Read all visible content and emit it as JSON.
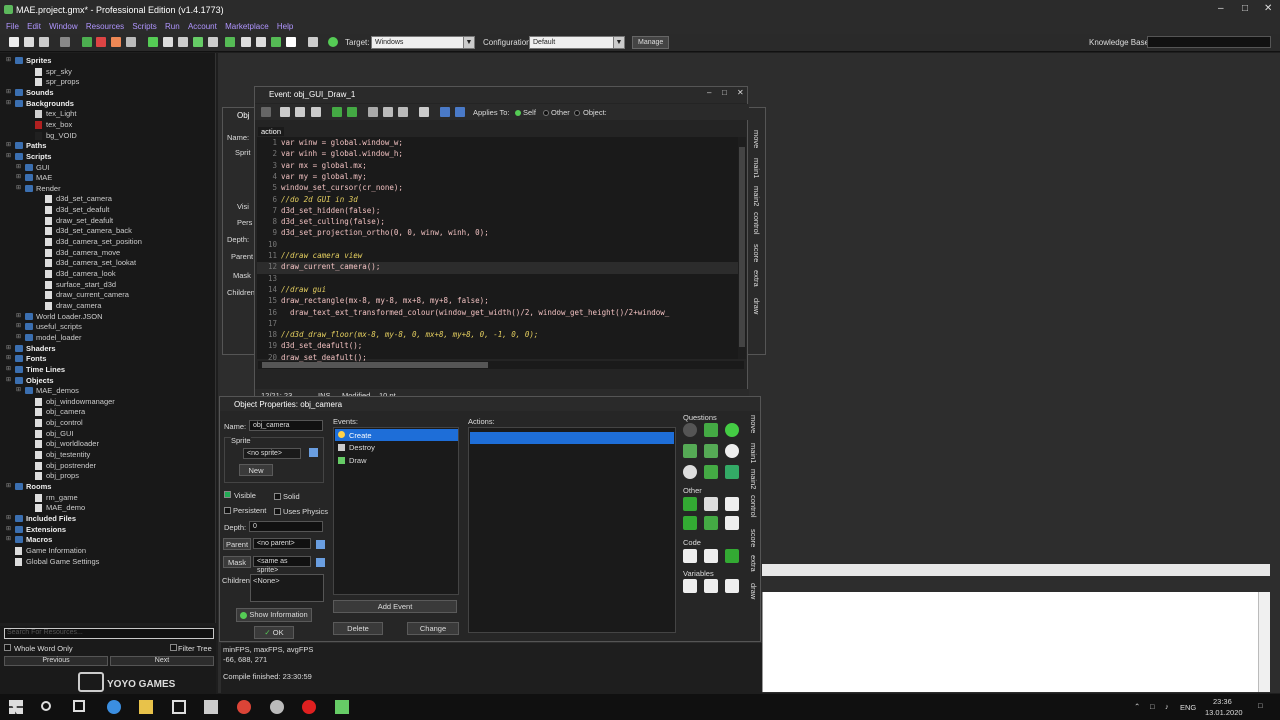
{
  "app": {
    "title": "MAE.project.gmx* - Professional Edition (v1.4.1773)"
  },
  "menu": [
    "File",
    "Edit",
    "Window",
    "Resources",
    "Scripts",
    "Run",
    "Account",
    "Marketplace",
    "Help"
  ],
  "toolbar": {
    "target_label": "Target:",
    "target_value": "Windows",
    "config_label": "Configuration:",
    "config_value": "Default",
    "manage_label": "Manage",
    "kb_label": "Knowledge Base:"
  },
  "tree": [
    {
      "label": "Sprites",
      "bold": true,
      "level": 1,
      "folder": true
    },
    {
      "label": "spr_sky",
      "level": 3
    },
    {
      "label": "spr_props",
      "level": 3
    },
    {
      "label": "Sounds",
      "bold": true,
      "level": 1,
      "folder": true
    },
    {
      "label": "Backgrounds",
      "bold": true,
      "level": 1,
      "folder": true
    },
    {
      "label": "tex_Light",
      "level": 3,
      "color": "#d0d0d0"
    },
    {
      "label": "tex_box",
      "level": 3,
      "color": "#b02020"
    },
    {
      "label": "bg_VOID",
      "level": 3,
      "color": "#202020"
    },
    {
      "label": "Paths",
      "bold": true,
      "level": 1,
      "folder": true
    },
    {
      "label": "Scripts",
      "bold": true,
      "level": 1,
      "folder": true
    },
    {
      "label": "GUI",
      "level": 2,
      "folder": true
    },
    {
      "label": "MAE",
      "level": 2,
      "folder": true
    },
    {
      "label": "Render",
      "level": 2,
      "folder": true
    },
    {
      "label": "d3d_set_camera",
      "level": 4
    },
    {
      "label": "d3d_set_deafult",
      "level": 4
    },
    {
      "label": "draw_set_deafult",
      "level": 4
    },
    {
      "label": "d3d_set_camera_back",
      "level": 4
    },
    {
      "label": "d3d_camera_set_position",
      "level": 4
    },
    {
      "label": "d3d_camera_move",
      "level": 4
    },
    {
      "label": "d3d_camera_set_lookat",
      "level": 4
    },
    {
      "label": "d3d_camera_look",
      "level": 4
    },
    {
      "label": "surface_start_d3d",
      "level": 4
    },
    {
      "label": "draw_current_camera",
      "level": 4
    },
    {
      "label": "draw_camera",
      "level": 4
    },
    {
      "label": "World Loader.JSON",
      "level": 2,
      "folder": true
    },
    {
      "label": "useful_scripts",
      "level": 2,
      "folder": true
    },
    {
      "label": "model_loader",
      "level": 2,
      "folder": true
    },
    {
      "label": "Shaders",
      "bold": true,
      "level": 1,
      "folder": true
    },
    {
      "label": "Fonts",
      "bold": true,
      "level": 1,
      "folder": true
    },
    {
      "label": "Time Lines",
      "bold": true,
      "level": 1,
      "folder": true
    },
    {
      "label": "Objects",
      "bold": true,
      "level": 1,
      "folder": true
    },
    {
      "label": "MAE_demos",
      "level": 2,
      "folder": true
    },
    {
      "label": "obj_windowmanager",
      "level": 3
    },
    {
      "label": "obj_camera",
      "level": 3
    },
    {
      "label": "obj_control",
      "level": 3
    },
    {
      "label": "obj_GUI",
      "level": 3
    },
    {
      "label": "obj_worldloader",
      "level": 3
    },
    {
      "label": "obj_testentity",
      "level": 3
    },
    {
      "label": "obj_postrender",
      "level": 3
    },
    {
      "label": "obj_props",
      "level": 3
    },
    {
      "label": "Rooms",
      "bold": true,
      "level": 1,
      "folder": true
    },
    {
      "label": "rm_game",
      "level": 3
    },
    {
      "label": "MAE_demo",
      "level": 3
    },
    {
      "label": "Included Files",
      "bold": true,
      "level": 1,
      "folder": true
    },
    {
      "label": "Extensions",
      "bold": true,
      "level": 1,
      "folder": true
    },
    {
      "label": "Macros",
      "bold": true,
      "level": 1,
      "folder": true
    },
    {
      "label": "Game Information",
      "level": 1
    },
    {
      "label": "Global Game Settings",
      "level": 1
    }
  ],
  "search": {
    "placeholder": "Search For Resources...",
    "whole_word": "Whole Word Only",
    "filter": "Filter Tree",
    "previous": "Previous",
    "next": "Next"
  },
  "logo": "YOYO GAMES",
  "event_window": {
    "title": "Event: obj_GUI_Draw_1",
    "tab": "action",
    "applies_to": "Applies To:",
    "self": "Self",
    "other": "Other",
    "object": "Object:",
    "status_pos": "12/21: 23",
    "status_ins": "INS",
    "status_mod": "Modified",
    "status_size": "10 pt",
    "code": [
      {
        "n": "1",
        "t": "var winw = global.window_w;"
      },
      {
        "n": "2",
        "t": "var winh = global.window_h;"
      },
      {
        "n": "3",
        "t": "var mx = global.mx;"
      },
      {
        "n": "4",
        "t": "var my = global.my;"
      },
      {
        "n": "5",
        "t": "window_set_cursor(cr_none);"
      },
      {
        "n": "6",
        "t": "//do 2d GUI in 3d",
        "c": true
      },
      {
        "n": "7",
        "t": "d3d_set_hidden(false);"
      },
      {
        "n": "8",
        "t": "d3d_set_culling(false);"
      },
      {
        "n": "9",
        "t": "d3d_set_projection_ortho(0, 0, winw, winh, 0);"
      },
      {
        "n": "10",
        "t": ""
      },
      {
        "n": "11",
        "t": "//draw camera view",
        "c": true
      },
      {
        "n": "12",
        "t": "draw_current_camera();",
        "hl": true
      },
      {
        "n": "13",
        "t": ""
      },
      {
        "n": "14",
        "t": "//draw gui",
        "c": true
      },
      {
        "n": "15",
        "t": "draw_rectangle(mx-8, my-8, mx+8, my+8, false);"
      },
      {
        "n": "16",
        "t": "  draw_text_ext_transformed_colour(window_get_width()/2, window_get_height()/2+window_"
      },
      {
        "n": "17",
        "t": ""
      },
      {
        "n": "18",
        "t": "//d3d_draw_floor(mx-8, my-8, 0, mx+8, my+8, 0, -1, 0, 0);",
        "c": true
      },
      {
        "n": "19",
        "t": "d3d_set_deafult();"
      },
      {
        "n": "20",
        "t": "draw_set_deafult();"
      }
    ],
    "side_tabs": [
      "move",
      "main1",
      "main2",
      "control",
      "score",
      "extra",
      "draw"
    ]
  },
  "object_window": {
    "title": "Object Properties: obj_camera",
    "name_label": "Name:",
    "name_value": "obj_camera",
    "sprite_label": "Sprite",
    "sprite_value": "<no sprite>",
    "new_label": "New",
    "visible": "Visible",
    "solid": "Solid",
    "persistent": "Persistent",
    "physics": "Uses Physics",
    "depth_label": "Depth:",
    "depth_value": "0",
    "parent_label": "Parent",
    "parent_value": "<no parent>",
    "mask_label": "Mask",
    "mask_value": "<same as sprite>",
    "children_label": "Children:",
    "children_value": "<None>",
    "show_info": "Show Information",
    "ok": "OK",
    "events_label": "Events:",
    "events": [
      "Create",
      "Destroy",
      "Draw"
    ],
    "actions_label": "Actions:",
    "add_event": "Add Event",
    "delete": "Delete",
    "change": "Change",
    "questions": "Questions",
    "other": "Other",
    "code": "Code",
    "variables": "Variables",
    "side_tabs": [
      "move",
      "main1",
      "main2",
      "control",
      "score",
      "extra",
      "draw"
    ]
  },
  "bg_window": {
    "title": "Obj",
    "name_label": "Name:",
    "sprite": "Sprit",
    "visible": "Visi",
    "persist": "Pers",
    "depth": "Depth:",
    "parent": "Parent",
    "mask": "Mask",
    "children": "Children:"
  },
  "output": {
    "line1": "minFPS, maxFPS, avgFPS",
    "line2": "-66, 688, 271",
    "line3": "Compile finished: 23:30:59"
  },
  "taskbar": {
    "lang": "ENG",
    "time": "23:36",
    "date": "13.01.2020"
  }
}
